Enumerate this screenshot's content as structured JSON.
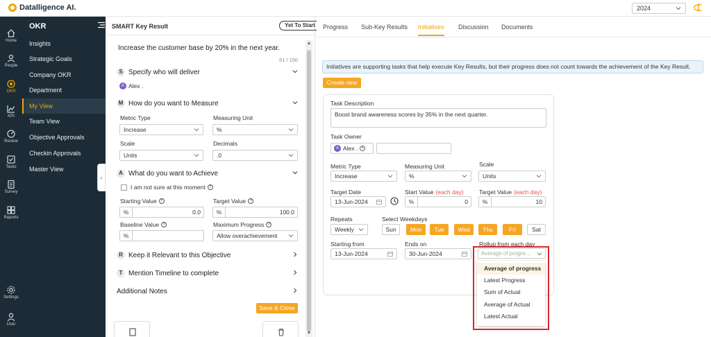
{
  "app": {
    "brand": "Datalligence AI.",
    "year": "2024",
    "accent": "#f5a623",
    "nav_bg": "#1d2b36",
    "highlight": "#d7262b"
  },
  "rail": [
    {
      "label": "Home",
      "icon": "home-icon"
    },
    {
      "label": "People",
      "icon": "people-icon"
    },
    {
      "label": "OKR",
      "icon": "target-icon",
      "active": true
    },
    {
      "label": "KPI",
      "icon": "chart-icon"
    },
    {
      "label": "Review",
      "icon": "gauge-icon"
    },
    {
      "label": "Tasks",
      "icon": "checklist-icon"
    },
    {
      "label": "Survey",
      "icon": "survey-icon"
    },
    {
      "label": "Reports",
      "icon": "reports-icon"
    },
    {
      "label": "Settings",
      "icon": "gear-icon"
    },
    {
      "label": "User",
      "icon": "user-icon"
    }
  ],
  "sidebar": {
    "title": "OKR",
    "items": [
      {
        "label": "Insights"
      },
      {
        "label": "Strategic Goals"
      },
      {
        "label": "Company OKR"
      },
      {
        "label": "Department"
      },
      {
        "label": "My View",
        "active": true
      },
      {
        "label": "Team View"
      },
      {
        "label": "Objective Approvals"
      },
      {
        "label": "Checkin Approvals"
      },
      {
        "label": "Master View"
      }
    ]
  },
  "left": {
    "title": "SMART Key Result",
    "status": "Yet To Start",
    "statement": "Increase the customer base by 20% in the next year.",
    "char_count": "51 / 150",
    "s_section": {
      "badge": "S",
      "label": "Specify who will deliver",
      "owner_initial": "A",
      "owner_name": "Alex ."
    },
    "m_section": {
      "badge": "M",
      "label": "How do you want to Measure",
      "metric_type_label": "Metric Type",
      "metric_type": "Increase",
      "unit_label": "Measuring Unit",
      "unit": "%",
      "scale_label": "Scale",
      "scale": "Units",
      "decimals_label": "Decimals",
      "decimals": ".0"
    },
    "a_section": {
      "badge": "A",
      "label": "What do you want to Achieve",
      "not_sure": "I am not sure at this moment",
      "starting_label": "Starting Value",
      "starting_unit": "%",
      "starting_value": "0.0",
      "target_label": "Target Value",
      "target_unit": "%",
      "target_value": "100.0",
      "baseline_label": "Baseline Value",
      "baseline_unit": "%",
      "max_progress_label": "Maximum Progress",
      "max_progress": "Allow overachievement"
    },
    "r_section": {
      "badge": "R",
      "label": "Keep it Relevant to this Objective"
    },
    "t_section": {
      "badge": "T",
      "label": "Mention Timeline to complete"
    },
    "notes_label": "Additional Notes",
    "save_close": "Save & Close"
  },
  "right": {
    "tabs": [
      "Progress",
      "Sub-Key Results",
      "Initiatives",
      "Discussion",
      "Documents"
    ],
    "active_tab": "Initiatives",
    "info": "Initiatives are supporting tasks that help execute Key Results, but their progress does not count towards the achievement of the Key Result.",
    "create_new": "Create new",
    "task": {
      "description_label": "Task Description",
      "description": "Boost brand awareness scores by 35% in the next quarter.",
      "owner_label": "Task Owner",
      "owner_initial": "A",
      "owner_name": "Alex .",
      "metric_type_label": "Metric Type",
      "metric_type": "Increase",
      "unit_label": "Measuring Unit",
      "unit": "%",
      "scale_label": "Scale",
      "scale": "Units",
      "target_date_label": "Target Date",
      "target_date": "13-Jun-2024",
      "start_value_label": "Start Value",
      "start_value_note": "(each day)",
      "start_unit": "%",
      "start_value": "0",
      "target_value_label": "Target Value",
      "target_value_note": "(each day)",
      "target_unit": "%",
      "target_value": "10",
      "repeats_label": "Repeats",
      "repeats": "Weekly",
      "weekdays_label": "Select Weekdays",
      "weekdays": [
        {
          "label": "Sun",
          "on": false
        },
        {
          "label": "Mon",
          "on": true
        },
        {
          "label": "Tue",
          "on": true
        },
        {
          "label": "Wed",
          "on": true
        },
        {
          "label": "Thu",
          "on": true
        },
        {
          "label": "Fri",
          "on": true
        },
        {
          "label": "Sat",
          "on": false
        }
      ],
      "starting_from_label": "Starting from",
      "starting_from": "13-Jun-2024",
      "ends_on_label": "Ends on",
      "ends_on": "30-Jun-2024",
      "rollup_label": "Rollup from each day",
      "rollup_placeholder": "Average of progre...",
      "rollup_options": [
        "Average of progress",
        "Latest Progress",
        "Sum of Actual",
        "Average of Actual",
        "Latest Actual"
      ],
      "rollup_selected": "Average of progress"
    }
  }
}
